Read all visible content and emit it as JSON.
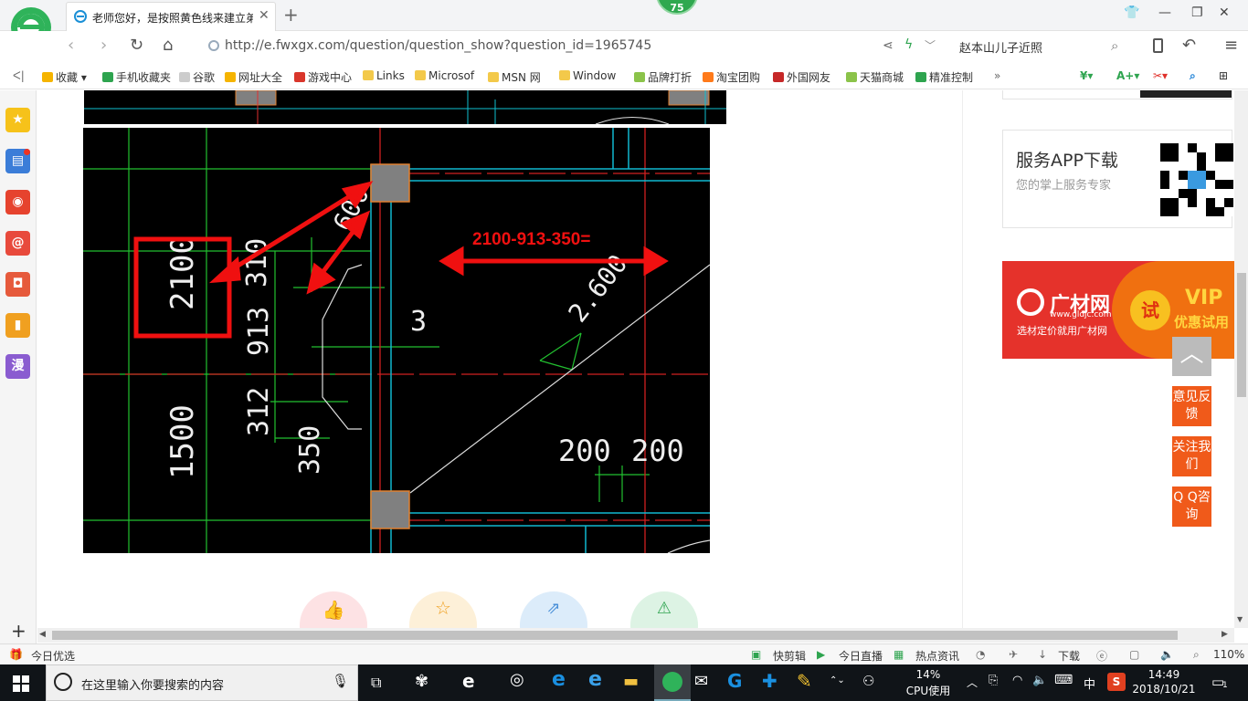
{
  "browser": {
    "tab_title": "老师您好，是按照黄色线来建立弟",
    "badge_number": "75",
    "url": "http://e.fwxgx.com/question/question_show?question_id=1965745",
    "search_query": "赵本山儿子近照"
  },
  "bookmarks": [
    {
      "label": "收藏",
      "color": "#f5b400"
    },
    {
      "label": "手机收藏夹",
      "color": "#2ea44f"
    },
    {
      "label": "谷歌",
      "color": "#cccccc"
    },
    {
      "label": "网址大全",
      "color": "#f5b400"
    },
    {
      "label": "游戏中心",
      "color": "#d9362b"
    },
    {
      "label": "Links",
      "color": "#f3c94a"
    },
    {
      "label": "Microsof",
      "color": "#f3c94a"
    },
    {
      "label": "MSN 网",
      "color": "#f3c94a"
    },
    {
      "label": "Window",
      "color": "#f3c94a"
    },
    {
      "label": "品牌打折",
      "color": "#8bc34a"
    },
    {
      "label": "淘宝团购",
      "color": "#ff7a1a"
    },
    {
      "label": "外国网友",
      "color": "#c62828"
    },
    {
      "label": "天猫商城",
      "color": "#8bc34a"
    },
    {
      "label": "精准控制",
      "color": "#2ea44f"
    }
  ],
  "sidebar_icons": [
    {
      "name": "star-icon",
      "glyph": "★",
      "color": "#f6c21a"
    },
    {
      "name": "news-icon",
      "glyph": "▤",
      "color": "#3b7dd8"
    },
    {
      "name": "weibo-icon",
      "glyph": "◉",
      "color": "#e6432e"
    },
    {
      "name": "mail-icon",
      "glyph": "@",
      "color": "#e84a3c"
    },
    {
      "name": "game-icon",
      "glyph": "◘",
      "color": "#e65a3c"
    },
    {
      "name": "note-icon",
      "glyph": "▮",
      "color": "#f0a020"
    },
    {
      "name": "comic-icon",
      "glyph": "漫",
      "color": "#8a5cd0"
    }
  ],
  "drawing": {
    "annotation": "2100-913-350=",
    "dims": {
      "d2100": "2100",
      "d310": "310",
      "d913": "913",
      "d312": "312",
      "d350": "350",
      "d1500": "1500",
      "d600": "600",
      "d2600": "2.600",
      "d3": "3",
      "d200a": "200",
      "d200b": "200"
    }
  },
  "right_panel": {
    "app_title": "服务APP下载",
    "app_desc": "您的掌上服务专家",
    "ad_brand": "广材网",
    "ad_url": "www.gldjc.com",
    "ad_slogan": "选材定价就用广材网",
    "ad_trial": "试",
    "ad_vip": "VIP",
    "ad_vip_sub": "优惠试用",
    "btn_feedback": "意见反馈",
    "btn_follow": "关注我们",
    "btn_qq": "Q Q咨询"
  },
  "statusbar": {
    "today": "今日优选",
    "quick_cut": "快剪辑",
    "live": "今日直播",
    "hot_news": "热点资讯",
    "download": "下载",
    "zoom": "110%"
  },
  "taskbar": {
    "search_placeholder": "在这里输入你要搜索的内容",
    "cpu_percent": "14%",
    "cpu_label": "CPU使用",
    "ime": "中",
    "time": "14:49",
    "date": "2018/10/21",
    "notif_count": "1"
  }
}
